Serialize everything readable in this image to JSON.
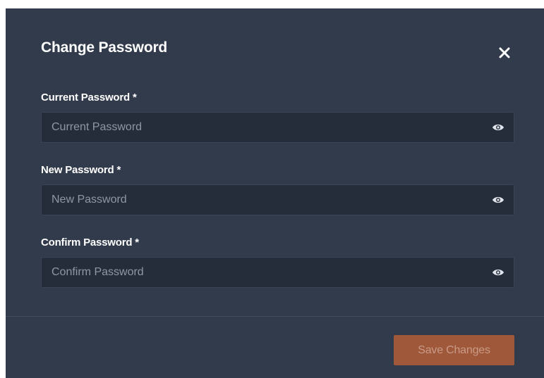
{
  "modal": {
    "title": "Change Password",
    "close_icon": "close-icon"
  },
  "fields": [
    {
      "label": "Current Password *",
      "placeholder": "Current Password",
      "value": "",
      "toggle_icon": "eye-icon"
    },
    {
      "label": "New Password *",
      "placeholder": "New Password",
      "value": "",
      "toggle_icon": "eye-icon"
    },
    {
      "label": "Confirm Password *",
      "placeholder": "Confirm Password",
      "value": "",
      "toggle_icon": "eye-icon"
    }
  ],
  "footer": {
    "save_label": "Save Changes"
  },
  "colors": {
    "modal_background": "#323b4b",
    "input_background": "#262d3a",
    "accent": "#a0583b",
    "text": "#ffffff"
  }
}
